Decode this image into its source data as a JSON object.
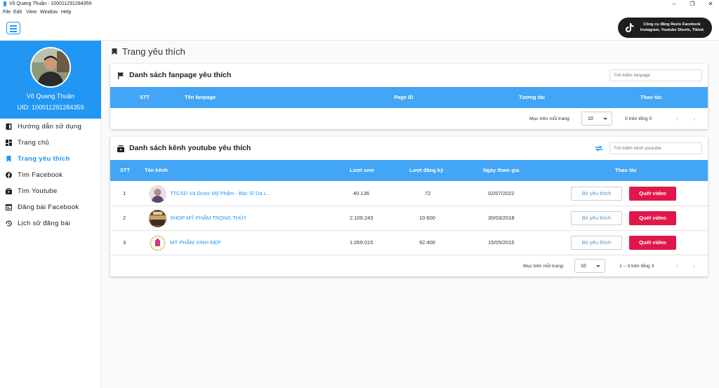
{
  "window": {
    "title": "Võ Quang Thuận - 100011291284359",
    "controls": [
      "–",
      "❐",
      "✕"
    ]
  },
  "menu": [
    "File",
    "Edit",
    "View",
    "Window",
    "Help"
  ],
  "promo": {
    "line1": "Công cụ đăng Reels Facebook",
    "line2": "Instagram, Youtube Shorts, Tiktok"
  },
  "profile": {
    "name": "Võ Quang Thuận",
    "uid": "UID: 100011291284359"
  },
  "nav": [
    {
      "label": "Hướng dẫn sử dụng",
      "icon": "book-icon"
    },
    {
      "label": "Trang chủ",
      "icon": "dashboard-icon"
    },
    {
      "label": "Trang yêu thích",
      "icon": "bookmark-icon",
      "active": true
    },
    {
      "label": "Tìm Facebook",
      "icon": "facebook-icon"
    },
    {
      "label": "Tìm Youtube",
      "icon": "youtube-icon"
    },
    {
      "label": "Đăng bài Facebook",
      "icon": "post-icon"
    },
    {
      "label": "Lịch sử đăng bài",
      "icon": "history-icon"
    }
  ],
  "page": {
    "title": "Trang yêu thích"
  },
  "fanpage": {
    "title": "Danh sách fanpage yêu thích",
    "search_placeholder": "Tìm kiếm fanpage",
    "columns": [
      "STT",
      "Tên fanpage",
      "Page ID",
      "Tương tác",
      "Thao tác"
    ],
    "per_page_label": "Mục trên mỗi trang:",
    "per_page": "10",
    "range": "0 trên tổng 0",
    "prev": "‹",
    "next": "›"
  },
  "youtube": {
    "title": "Danh sách kênh youtube yêu thích",
    "search_placeholder": "Tìm kiếm kênh youtube",
    "columns": [
      "STT",
      "Tên kênh",
      "Lượt xem",
      "Lượt đăng ký",
      "Ngày tham gia",
      "Thao tác"
    ],
    "rows": [
      {
        "stt": "1",
        "name": "TTCSD Và Dược Mỹ Phẩm - Bác Sĩ Da L...",
        "views": "40.136",
        "subs": "72",
        "joined": "02/07/2022",
        "unlike": "Bỏ yêu thích",
        "scan": "Quét video"
      },
      {
        "stt": "2",
        "name": "SHOP MỸ PHẨM TRỌNG THÚY",
        "views": "2.109.243",
        "subs": "10.600",
        "joined": "30/03/2018",
        "unlike": "Bỏ yêu thích",
        "scan": "Quét video"
      },
      {
        "stt": "3",
        "name": "MỸ PHẨM XINH ĐẸP",
        "views": "1.059.015",
        "subs": "92.400",
        "joined": "15/05/2015",
        "unlike": "Bỏ yêu thích",
        "scan": "Quét video"
      }
    ],
    "per_page_label": "Mục trên mỗi trang:",
    "per_page": "10",
    "range": "1 – 3 trên tổng 3",
    "prev": "‹",
    "next": "›"
  },
  "colors": {
    "primary": "#2196f3",
    "table_header": "#42a5f5",
    "danger": "#e0174a"
  }
}
